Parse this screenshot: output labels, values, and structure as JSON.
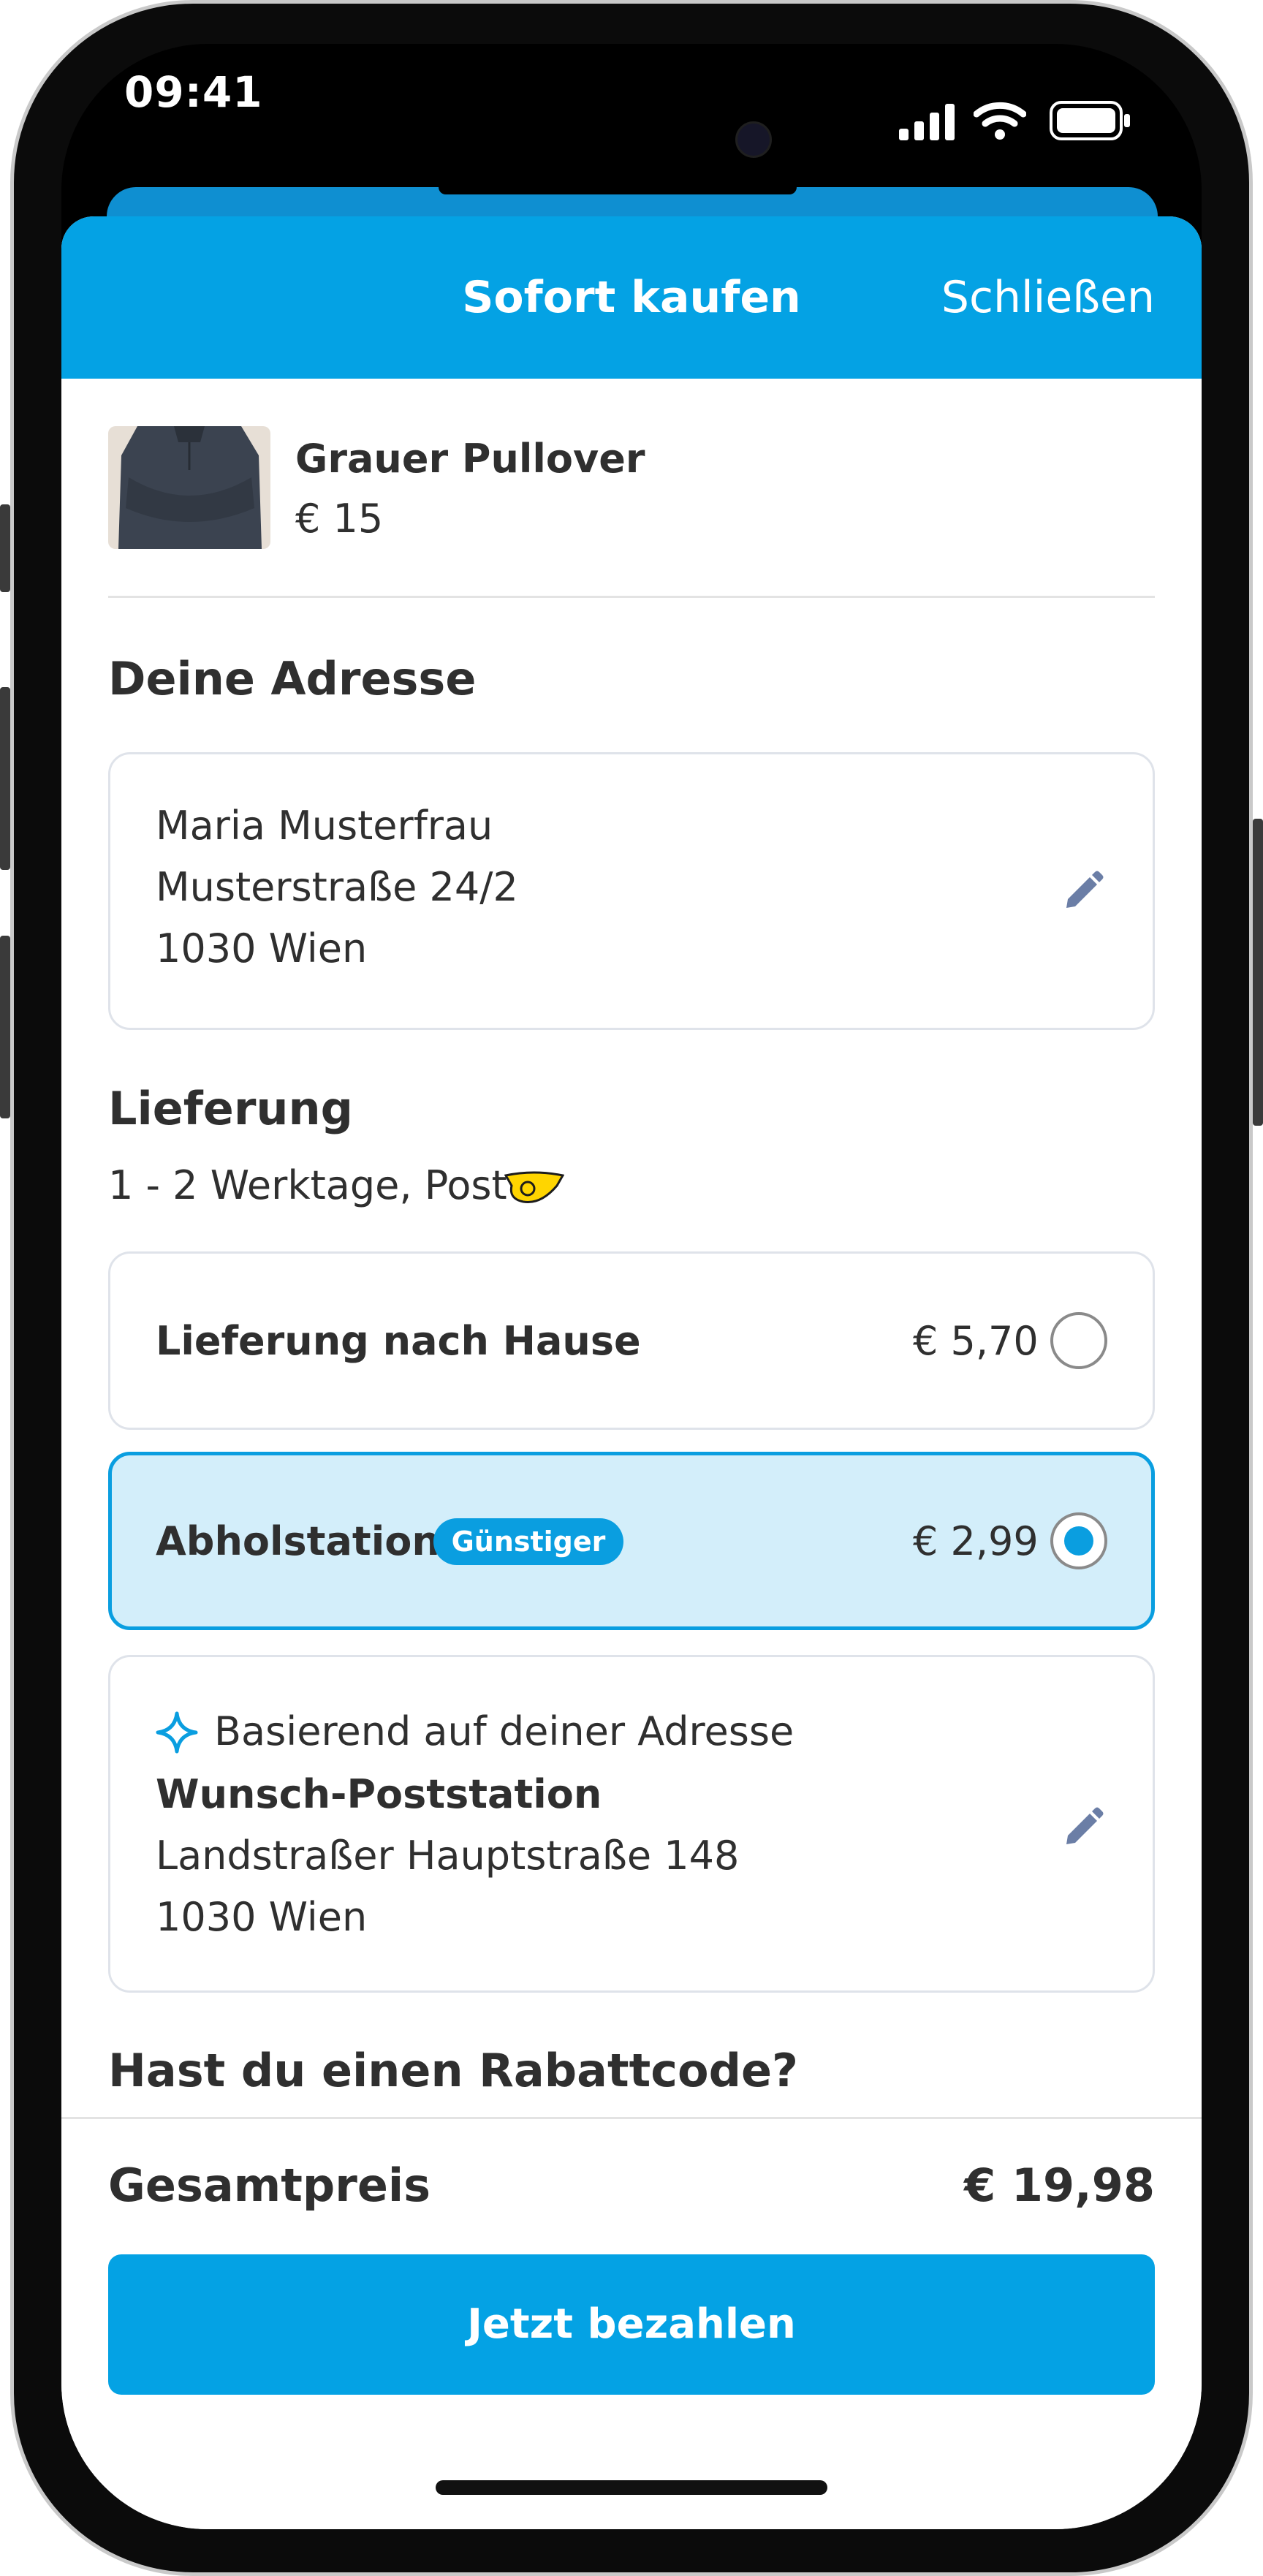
{
  "status_bar": {
    "time": "09:41"
  },
  "header": {
    "title": "Sofort kaufen",
    "close_label": "Schließen"
  },
  "product": {
    "name": "Grauer Pullover",
    "price": "€ 15"
  },
  "address_section": {
    "heading": "Deine Adresse",
    "lines": [
      "Maria Musterfrau",
      "Musterstraße 24/2",
      "1030 Wien"
    ]
  },
  "delivery_section": {
    "heading": "Lieferung",
    "subtitle": "1 - 2 Werktage, Post",
    "options": [
      {
        "label": "Lieferung nach Hause",
        "price": "€ 5,70",
        "selected": false
      },
      {
        "label": "Abholstation",
        "badge": "Günstiger",
        "price": "€ 2,99",
        "selected": true
      }
    ]
  },
  "pickup_station": {
    "hint": "Basierend auf deiner Adresse",
    "name": "Wunsch-Poststation",
    "street": "Landstraßer Hauptstraße 148",
    "city": "1030 Wien"
  },
  "discount": {
    "heading": "Hast du einen Rabattcode?"
  },
  "footer": {
    "total_label": "Gesamtpreis",
    "total_value": "€ 19,98",
    "pay_button": "Jetzt bezahlen"
  },
  "colors": {
    "brand": "#04a2e4",
    "selected_background": "#d3eefa",
    "text": "#2f2f2f",
    "post_yellow": "#ffd500"
  },
  "icons": [
    "signal-icon",
    "wifi-icon",
    "battery-icon",
    "edit-icon",
    "sparkle-icon",
    "post-horn-icon"
  ]
}
